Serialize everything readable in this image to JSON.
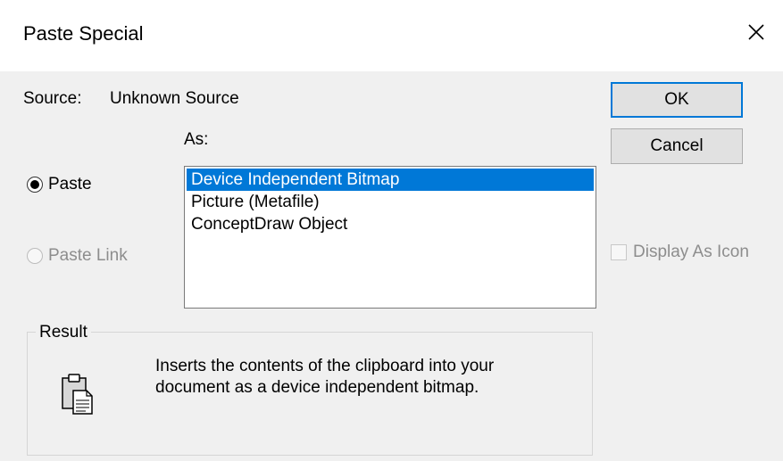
{
  "window": {
    "title": "Paste Special"
  },
  "icons": {
    "close": "close-icon",
    "clipboard": "clipboard-icon"
  },
  "source": {
    "label": "Source:",
    "value": "Unknown Source"
  },
  "as_label": "As:",
  "buttons": {
    "ok": "OK",
    "cancel": "Cancel"
  },
  "options": {
    "paste": {
      "label": "Paste",
      "selected": true
    },
    "paste_link": {
      "label": "Paste Link",
      "enabled": false
    }
  },
  "formats": {
    "selected_index": 0,
    "items": [
      {
        "label": "Device Independent Bitmap"
      },
      {
        "label": "Picture (Metafile)"
      },
      {
        "label": "ConceptDraw Object"
      }
    ]
  },
  "display_as_icon": {
    "label": "Display As Icon",
    "checked": false,
    "enabled": false
  },
  "result": {
    "legend": "Result",
    "line1": "Inserts the contents of the clipboard into your",
    "line2": "document as a device independent bitmap."
  },
  "colors": {
    "accent": "#0078d7",
    "dialog_bg": "#f0f0f0",
    "disabled_text": "#8d8d8d"
  }
}
